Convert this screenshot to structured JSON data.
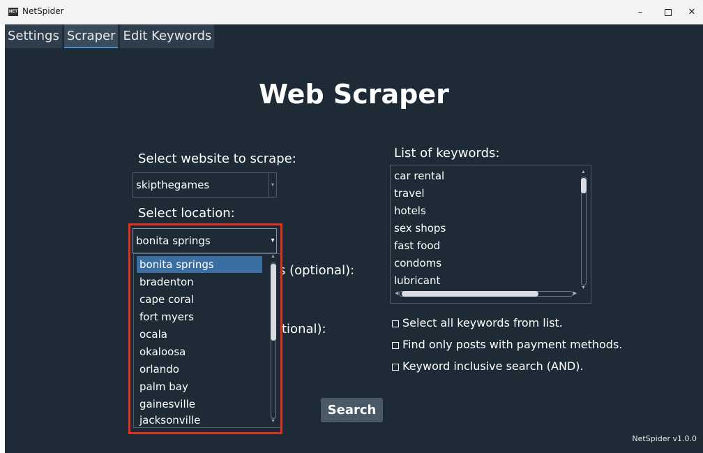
{
  "window": {
    "app_icon_text": "NET",
    "title": "NetSpider",
    "minimize": "–",
    "close": "✕"
  },
  "tabs": [
    {
      "label": "Settings"
    },
    {
      "label": "Scraper",
      "active": true
    },
    {
      "label": "Edit Keywords"
    }
  ],
  "main": {
    "heading": "Web Scraper",
    "website_label": "Select website to scrape:",
    "website_value": "skipthegames",
    "location_label": "Select location:",
    "location_value": "bonita springs",
    "hidden_label_1_visible_part": "s (optional):",
    "hidden_label_2_visible_part": "tional):",
    "location_options": [
      "bonita springs",
      "bradenton",
      "cape coral",
      "fort myers",
      "ocala",
      "okaloosa",
      "orlando",
      "palm bay",
      "gainesville",
      "jacksonville"
    ],
    "keywords_label": "List of keywords:",
    "keywords": [
      "car rental",
      "travel",
      "hotels",
      "sex shops",
      "fast food",
      "condoms",
      "lubricant"
    ],
    "checkboxes": [
      "Select all keywords from list.",
      "Find only posts with payment methods.",
      "Keyword inclusive search (AND)."
    ],
    "search_button": "Search",
    "version": "NetSpider v1.0.0"
  },
  "colors": {
    "background": "#1e2a35",
    "selected_option": "#3b6fa3",
    "highlight_border": "#e0301e",
    "button": "#4a5968"
  }
}
